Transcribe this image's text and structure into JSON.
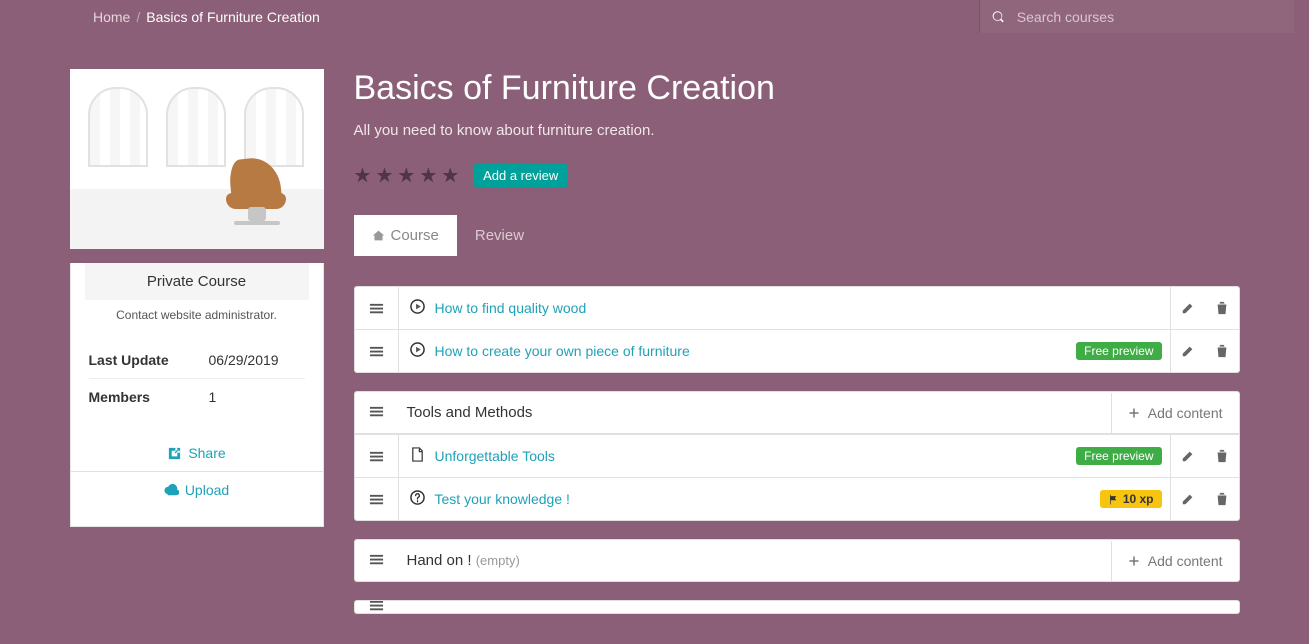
{
  "breadcrumb": {
    "home": "Home",
    "current": "Basics of Furniture Creation"
  },
  "search": {
    "placeholder": "Search courses"
  },
  "course": {
    "title": "Basics of Furniture Creation",
    "subtitle": "All you need to know about furniture creation.",
    "add_review": "Add a review"
  },
  "tabs": {
    "course": "Course",
    "review": "Review"
  },
  "sidebar": {
    "badge": "Private Course",
    "contact": "Contact website administrator.",
    "last_update_label": "Last Update",
    "last_update_value": "06/29/2019",
    "members_label": "Members",
    "members_value": "1",
    "share": "Share",
    "upload": "Upload"
  },
  "sections": [
    {
      "title": null,
      "items": [
        {
          "icon": "play",
          "label": "How to find quality wood",
          "badges": []
        },
        {
          "icon": "play",
          "label": "How to create your own piece of furniture",
          "badges": [
            "free_preview"
          ]
        }
      ]
    },
    {
      "title": "Tools and Methods",
      "add_content": "Add content",
      "items": [
        {
          "icon": "file",
          "label": "Unforgettable Tools",
          "badges": [
            "free_preview"
          ]
        },
        {
          "icon": "question",
          "label": "Test your knowledge !",
          "badges": [
            "xp"
          ],
          "xp": "10 xp"
        }
      ]
    },
    {
      "title": "Hand on !",
      "empty_suffix": "(empty)",
      "add_content": "Add content",
      "items": []
    }
  ],
  "labels": {
    "free_preview": "Free preview",
    "add_content": "Add content"
  }
}
